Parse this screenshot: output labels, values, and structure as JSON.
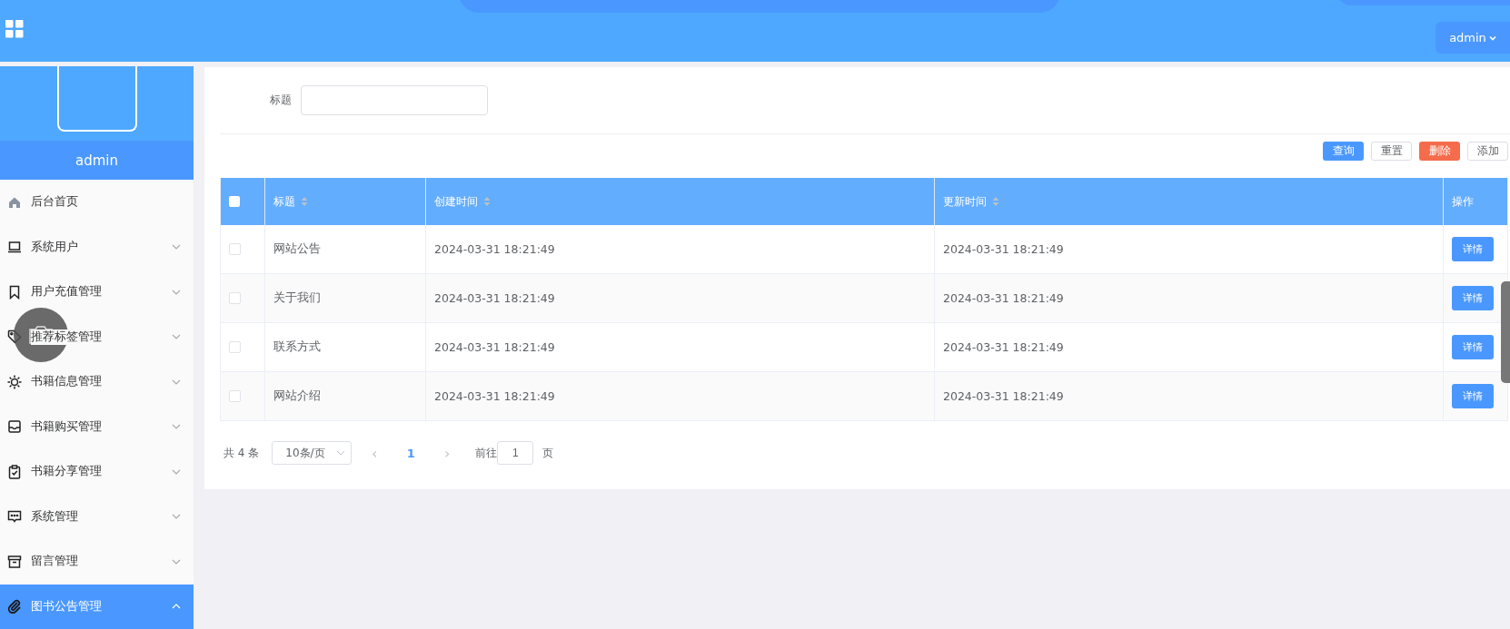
{
  "header": {
    "user_menu": "admin"
  },
  "sidebar": {
    "user_name": "admin",
    "items": [
      {
        "label": "后台首页",
        "kind": "link",
        "selected": false
      },
      {
        "label": "系统用户",
        "kind": "submenu",
        "expanded": false,
        "selected": false
      },
      {
        "label": "用户充值管理",
        "kind": "submenu",
        "expanded": false,
        "selected": false
      },
      {
        "label": "推荐标签管理",
        "kind": "submenu",
        "expanded": false,
        "selected": false
      },
      {
        "label": "书籍信息管理",
        "kind": "submenu",
        "expanded": false,
        "selected": false
      },
      {
        "label": "书籍购买管理",
        "kind": "submenu",
        "expanded": false,
        "selected": false
      },
      {
        "label": "书籍分享管理",
        "kind": "submenu",
        "expanded": false,
        "selected": false
      },
      {
        "label": "系统管理",
        "kind": "submenu",
        "expanded": false,
        "selected": false
      },
      {
        "label": "留言管理",
        "kind": "submenu",
        "expanded": false,
        "selected": false
      },
      {
        "label": "图书公告管理",
        "kind": "submenu",
        "expanded": true,
        "selected": true
      }
    ]
  },
  "search": {
    "label": "标题"
  },
  "actions": [
    {
      "label": "查询",
      "kind": "primary"
    },
    {
      "label": "重置",
      "kind": "plain"
    },
    {
      "label": "删除",
      "kind": "danger"
    },
    {
      "label": "添加",
      "kind": "plain"
    }
  ],
  "table": {
    "select_all_checked": false,
    "columns": [
      {
        "label": "标题",
        "sortable": true
      },
      {
        "label": "创建时间",
        "sortable": true
      },
      {
        "label": "更新时间",
        "sortable": true
      },
      {
        "label": "操作",
        "sortable": false
      }
    ],
    "rows": [
      {
        "checked": false,
        "title": "网站公告",
        "created": "2024-03-31 18:21:49",
        "updated": "2024-03-31 18:21:49",
        "action": "详情"
      },
      {
        "checked": false,
        "title": "关于我们",
        "created": "2024-03-31 18:21:49",
        "updated": "2024-03-31 18:21:49",
        "action": "详情"
      },
      {
        "checked": false,
        "title": "联系方式",
        "created": "2024-03-31 18:21:49",
        "updated": "2024-03-31 18:21:49",
        "action": "详情"
      },
      {
        "checked": false,
        "title": "网站介绍",
        "created": "2024-03-31 18:21:49",
        "updated": "2024-03-31 18:21:49",
        "action": "详情"
      }
    ]
  },
  "pagination": {
    "total": "共 4 条",
    "page_size": "10条/页",
    "prev": "‹",
    "pages": [
      {
        "label": "1",
        "selected": true
      }
    ],
    "next": "›",
    "goto_label": "前往",
    "goto_value": "1",
    "goto_suffix": "页"
  }
}
